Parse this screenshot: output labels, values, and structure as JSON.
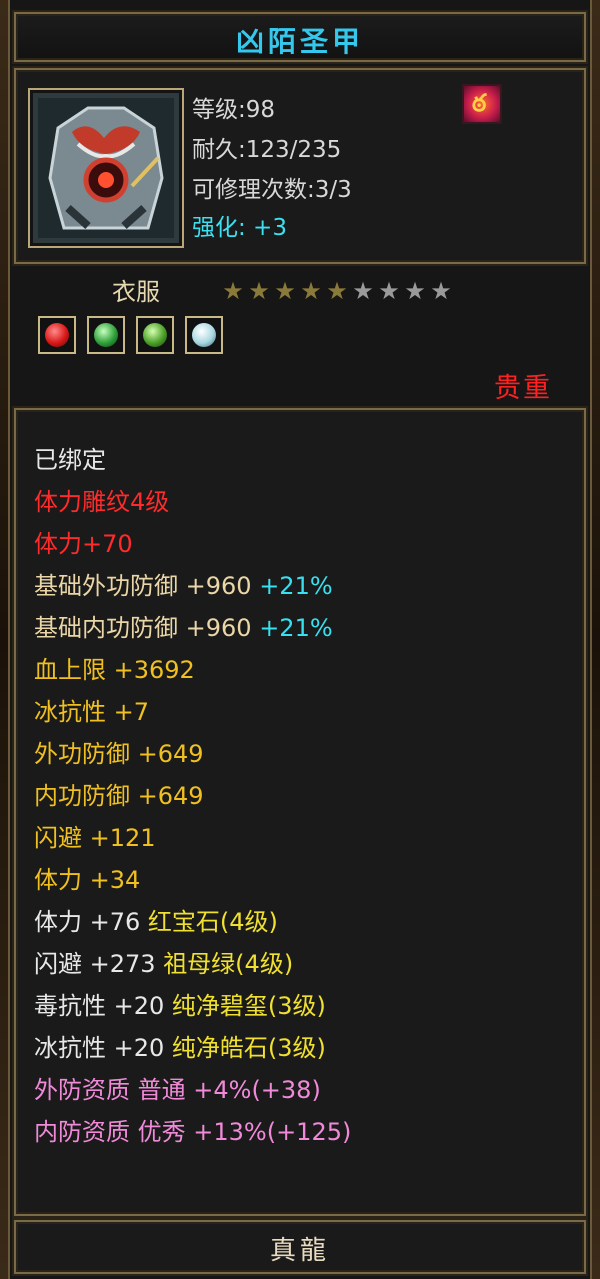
{
  "title": "凶陌圣甲",
  "info": {
    "level": "等级:98",
    "durability": "耐久:123/235",
    "repair": "可修理次数:3/3",
    "enhance": "强化: +3"
  },
  "quality_icon": "flame-quality-icon",
  "category": "衣服",
  "stars": {
    "filled": 5,
    "total": 9
  },
  "gems": [
    "ruby-gem-icon",
    "emerald-gem-icon",
    "emerald-gem-icon",
    "jade-gem-icon"
  ],
  "rarity": "贵重",
  "stats": [
    {
      "parts": [
        {
          "text": "已绑定",
          "color": "white"
        }
      ]
    },
    {
      "parts": [
        {
          "text": "体力雕纹4级",
          "color": "red"
        }
      ]
    },
    {
      "parts": [
        {
          "text": "体力+70",
          "color": "red"
        }
      ]
    },
    {
      "parts": [
        {
          "text": "基础外功防御 +960 ",
          "color": "tan"
        },
        {
          "text": "+21%",
          "color": "cyan"
        }
      ]
    },
    {
      "parts": [
        {
          "text": "基础内功防御 +960 ",
          "color": "tan"
        },
        {
          "text": "+21%",
          "color": "cyan"
        }
      ]
    },
    {
      "parts": [
        {
          "text": "血上限 +3692",
          "color": "gold"
        }
      ]
    },
    {
      "parts": [
        {
          "text": "冰抗性 +7",
          "color": "gold"
        }
      ]
    },
    {
      "parts": [
        {
          "text": "外功防御 +649",
          "color": "gold"
        }
      ]
    },
    {
      "parts": [
        {
          "text": "内功防御 +649",
          "color": "gold"
        }
      ]
    },
    {
      "parts": [
        {
          "text": "闪避 +121",
          "color": "gold"
        }
      ]
    },
    {
      "parts": [
        {
          "text": "体力 +34",
          "color": "gold"
        }
      ]
    },
    {
      "parts": [
        {
          "text": "体力 +76 ",
          "color": "white"
        },
        {
          "text": "红宝石(4级)",
          "color": "lime"
        }
      ]
    },
    {
      "parts": [
        {
          "text": "闪避 +273 ",
          "color": "white"
        },
        {
          "text": "祖母绿(4级)",
          "color": "lime"
        }
      ]
    },
    {
      "parts": [
        {
          "text": "毒抗性 +20 ",
          "color": "white"
        },
        {
          "text": "纯净碧玺(3级)",
          "color": "lime"
        }
      ]
    },
    {
      "parts": [
        {
          "text": "冰抗性 +20 ",
          "color": "white"
        },
        {
          "text": "纯净皓石(3级)",
          "color": "lime"
        }
      ]
    },
    {
      "parts": [
        {
          "text": "外防资质  普通 +4%(+38)",
          "color": "pink"
        }
      ]
    },
    {
      "parts": [
        {
          "text": "内防资质  优秀 +13%(+125)",
          "color": "pink"
        }
      ]
    }
  ],
  "footer": "真龍"
}
